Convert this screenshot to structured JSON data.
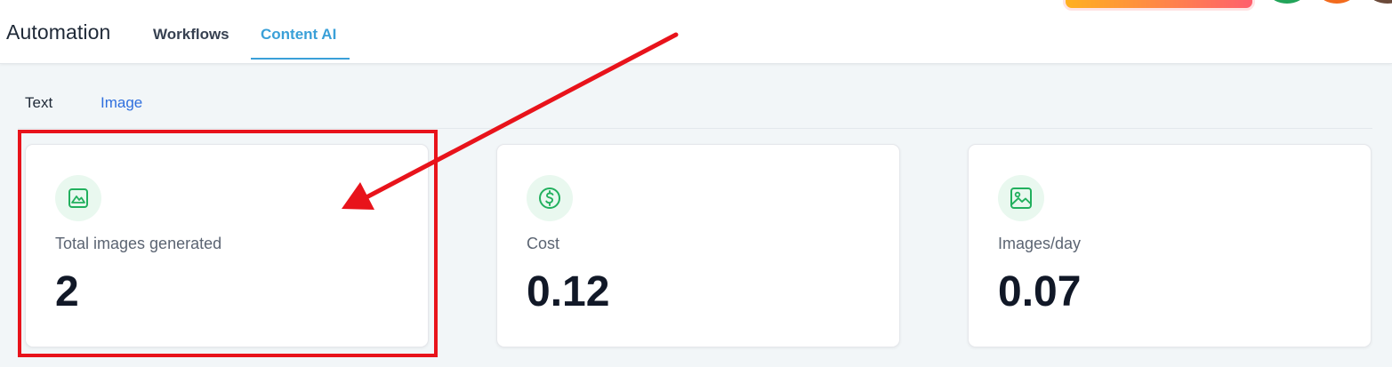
{
  "header": {
    "app_title": "Automation",
    "tabs": [
      {
        "label": "Workflows",
        "active": false
      },
      {
        "label": "Content AI",
        "active": true
      }
    ]
  },
  "subtabs": [
    {
      "label": "Text",
      "active": false
    },
    {
      "label": "Image",
      "active": true
    }
  ],
  "cards": [
    {
      "icon": "image-frame-icon",
      "label": "Total images generated",
      "value": "2"
    },
    {
      "icon": "dollar-icon",
      "label": "Cost",
      "value": "0.12"
    },
    {
      "icon": "picture-icon",
      "label": "Images/day",
      "value": "0.07"
    }
  ],
  "colors": {
    "accent": "#3aa0d8",
    "subtab_active": "#2f6fde",
    "icon_green": "#22b05e",
    "highlight_red": "#e8131b"
  }
}
